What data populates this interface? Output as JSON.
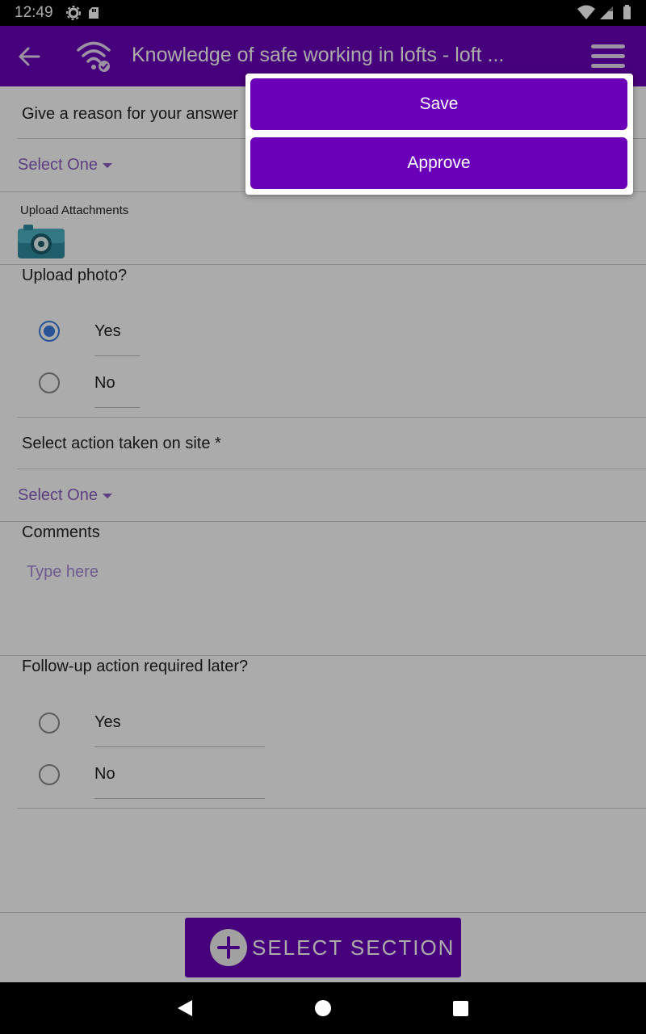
{
  "status_bar": {
    "time": "12:49"
  },
  "app_bar": {
    "title": "Knowledge of safe working in lofts - loft ..."
  },
  "form": {
    "reason_label": "Give a reason for your answer",
    "reason_select": "Select One",
    "upload_attachments_label": "Upload Attachments",
    "upload_photo_question": "Upload photo?",
    "upload_photo_options": [
      "Yes",
      "No"
    ],
    "upload_photo_selected": "Yes",
    "action_taken_label": "Select action taken on site *",
    "action_taken_select": "Select One",
    "comments_label": "Comments",
    "comments_placeholder": "Type here",
    "followup_question": "Follow-up action required later?",
    "followup_options": [
      "Yes",
      "No"
    ]
  },
  "fab": {
    "label": "SELECT SECTION"
  },
  "menu_popup": {
    "save_label": "Save",
    "approve_label": "Approve"
  },
  "colors": {
    "primary": "#6a00b8",
    "accent_select": "#8a5fc0",
    "radio_checked": "#3c7ee0"
  },
  "icons": {
    "status_left": [
      "gear-icon",
      "sd-card-icon"
    ],
    "status_right": [
      "wifi-icon",
      "cell-signal-icon",
      "battery-icon"
    ],
    "app_bar": [
      "back-arrow-icon",
      "wifi-sync-icon",
      "hamburger-menu-icon"
    ],
    "nav_bar": [
      "back-triangle-icon",
      "home-circle-icon",
      "recents-square-icon"
    ]
  }
}
